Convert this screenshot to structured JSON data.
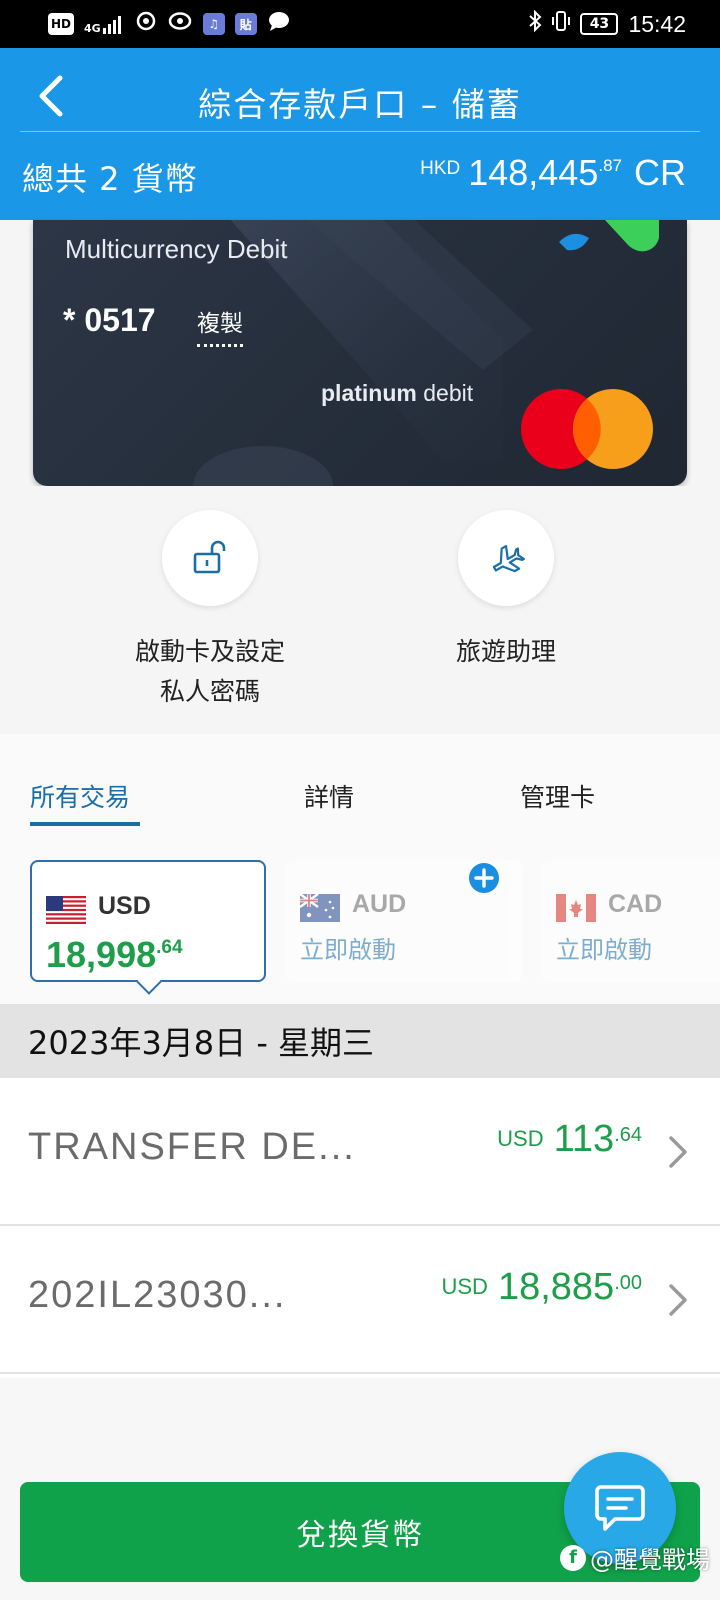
{
  "status_bar": {
    "left_icons": [
      "hd-icon",
      "signal-4g-icon",
      "app-icon-1",
      "app-icon-2",
      "music-app-icon",
      "sticker-app-icon",
      "message-bubble-icon"
    ],
    "hd_label": "HD",
    "network_label": "4G",
    "sticker_label": "貼",
    "battery": "43",
    "time": "15:42"
  },
  "header": {
    "title": "綜合存款戶口 – 儲蓄",
    "currency_count": "總共 2 貨幣",
    "total_currency": "HKD",
    "total_int": "148,445",
    "total_dec": ".87",
    "total_suffix": "CR"
  },
  "card": {
    "product_name": "Multicurrency Debit",
    "number": "* 0517",
    "copy_label": "複製",
    "tier_strong": "platinum",
    "tier_light": "debit"
  },
  "actions": [
    {
      "label_line1": "啟動卡及設定",
      "label_line2": "私人密碼",
      "icon": "unlock-icon"
    },
    {
      "label_line1": "旅遊助理",
      "icon": "airplane-icon"
    }
  ],
  "tabs": [
    {
      "label": "所有交易",
      "active": true
    },
    {
      "label": "詳情",
      "active": false
    },
    {
      "label": "管理卡",
      "active": false
    }
  ],
  "currencies": [
    {
      "code": "USD",
      "amount_int": "18,998",
      "amount_dec": ".64",
      "selected": true,
      "flag": "us-flag-icon"
    },
    {
      "code": "AUD",
      "status": "立即啟動",
      "selected": false,
      "flag": "au-flag-icon"
    },
    {
      "code": "CAD",
      "status": "立即啟動",
      "selected": false,
      "flag": "ca-flag-icon"
    }
  ],
  "date_header": "2023年3月8日 - 星期三",
  "transactions": [
    {
      "description": "TRANSFER DE...",
      "currency": "USD",
      "amount_int": "113",
      "amount_dec": ".64"
    },
    {
      "description": "202IL23030...",
      "currency": "USD",
      "amount_int": "18,885",
      "amount_dec": ".00"
    }
  ],
  "exchange_button": "兌換貨幣",
  "watermark": "@醒覺戰場",
  "colors": {
    "header_blue": "#1a97e6",
    "accent_blue": "#1a6fa8",
    "green": "#10a24a",
    "amount_green": "#1e9e4a",
    "fab_blue": "#29a8e8"
  }
}
